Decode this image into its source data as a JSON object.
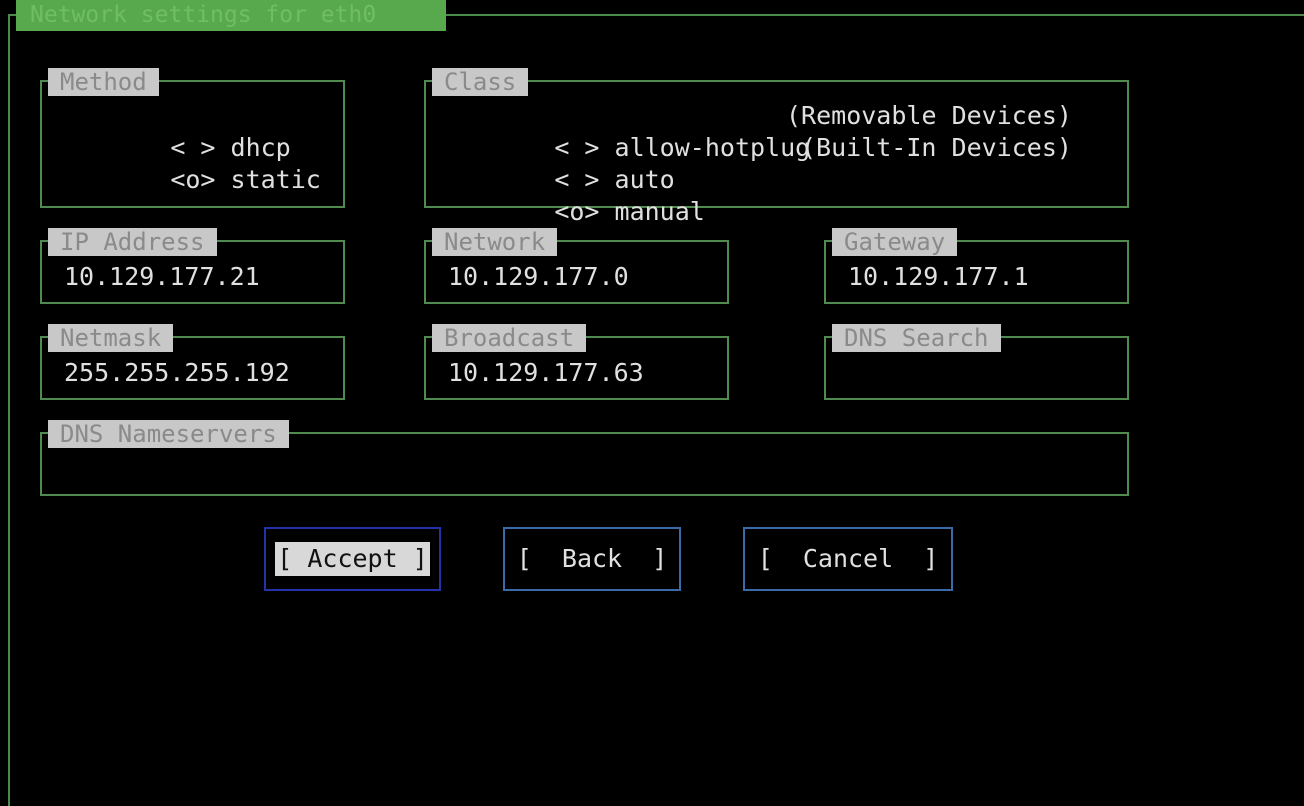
{
  "window": {
    "title": "Network settings for eth0"
  },
  "method": {
    "label": "Method",
    "options": [
      {
        "marker": "< >",
        "text": "dhcp"
      },
      {
        "marker": "<o>",
        "text": "static"
      }
    ]
  },
  "class": {
    "label": "Class",
    "options": [
      {
        "marker": "< >",
        "text": "allow-hotplug",
        "note": "(Removable Devices)"
      },
      {
        "marker": "< >",
        "text": "auto",
        "note": "(Built-In Devices)"
      },
      {
        "marker": "<o>",
        "text": "manual",
        "note": ""
      }
    ]
  },
  "fields": {
    "ip_address": {
      "label": "IP Address",
      "value": "10.129.177.21"
    },
    "network": {
      "label": "Network",
      "value": "10.129.177.0"
    },
    "gateway": {
      "label": "Gateway",
      "value": "10.129.177.1"
    },
    "netmask": {
      "label": "Netmask",
      "value": "255.255.255.192"
    },
    "broadcast": {
      "label": "Broadcast",
      "value": "10.129.177.63"
    },
    "dns_search": {
      "label": "DNS Search",
      "value": ""
    },
    "dns_nameservers": {
      "label": "DNS Nameservers",
      "value": ""
    }
  },
  "buttons": {
    "accept": "[ Accept ]",
    "back": "[  Back  ]",
    "cancel": "[  Cancel  ]"
  },
  "colors": {
    "frame": "#4f8a4f",
    "title_bar": "#58a94e",
    "label_bg": "#c8c8c8",
    "button_border": "#3a6aa8",
    "focused_button_border": "#2233aa"
  }
}
